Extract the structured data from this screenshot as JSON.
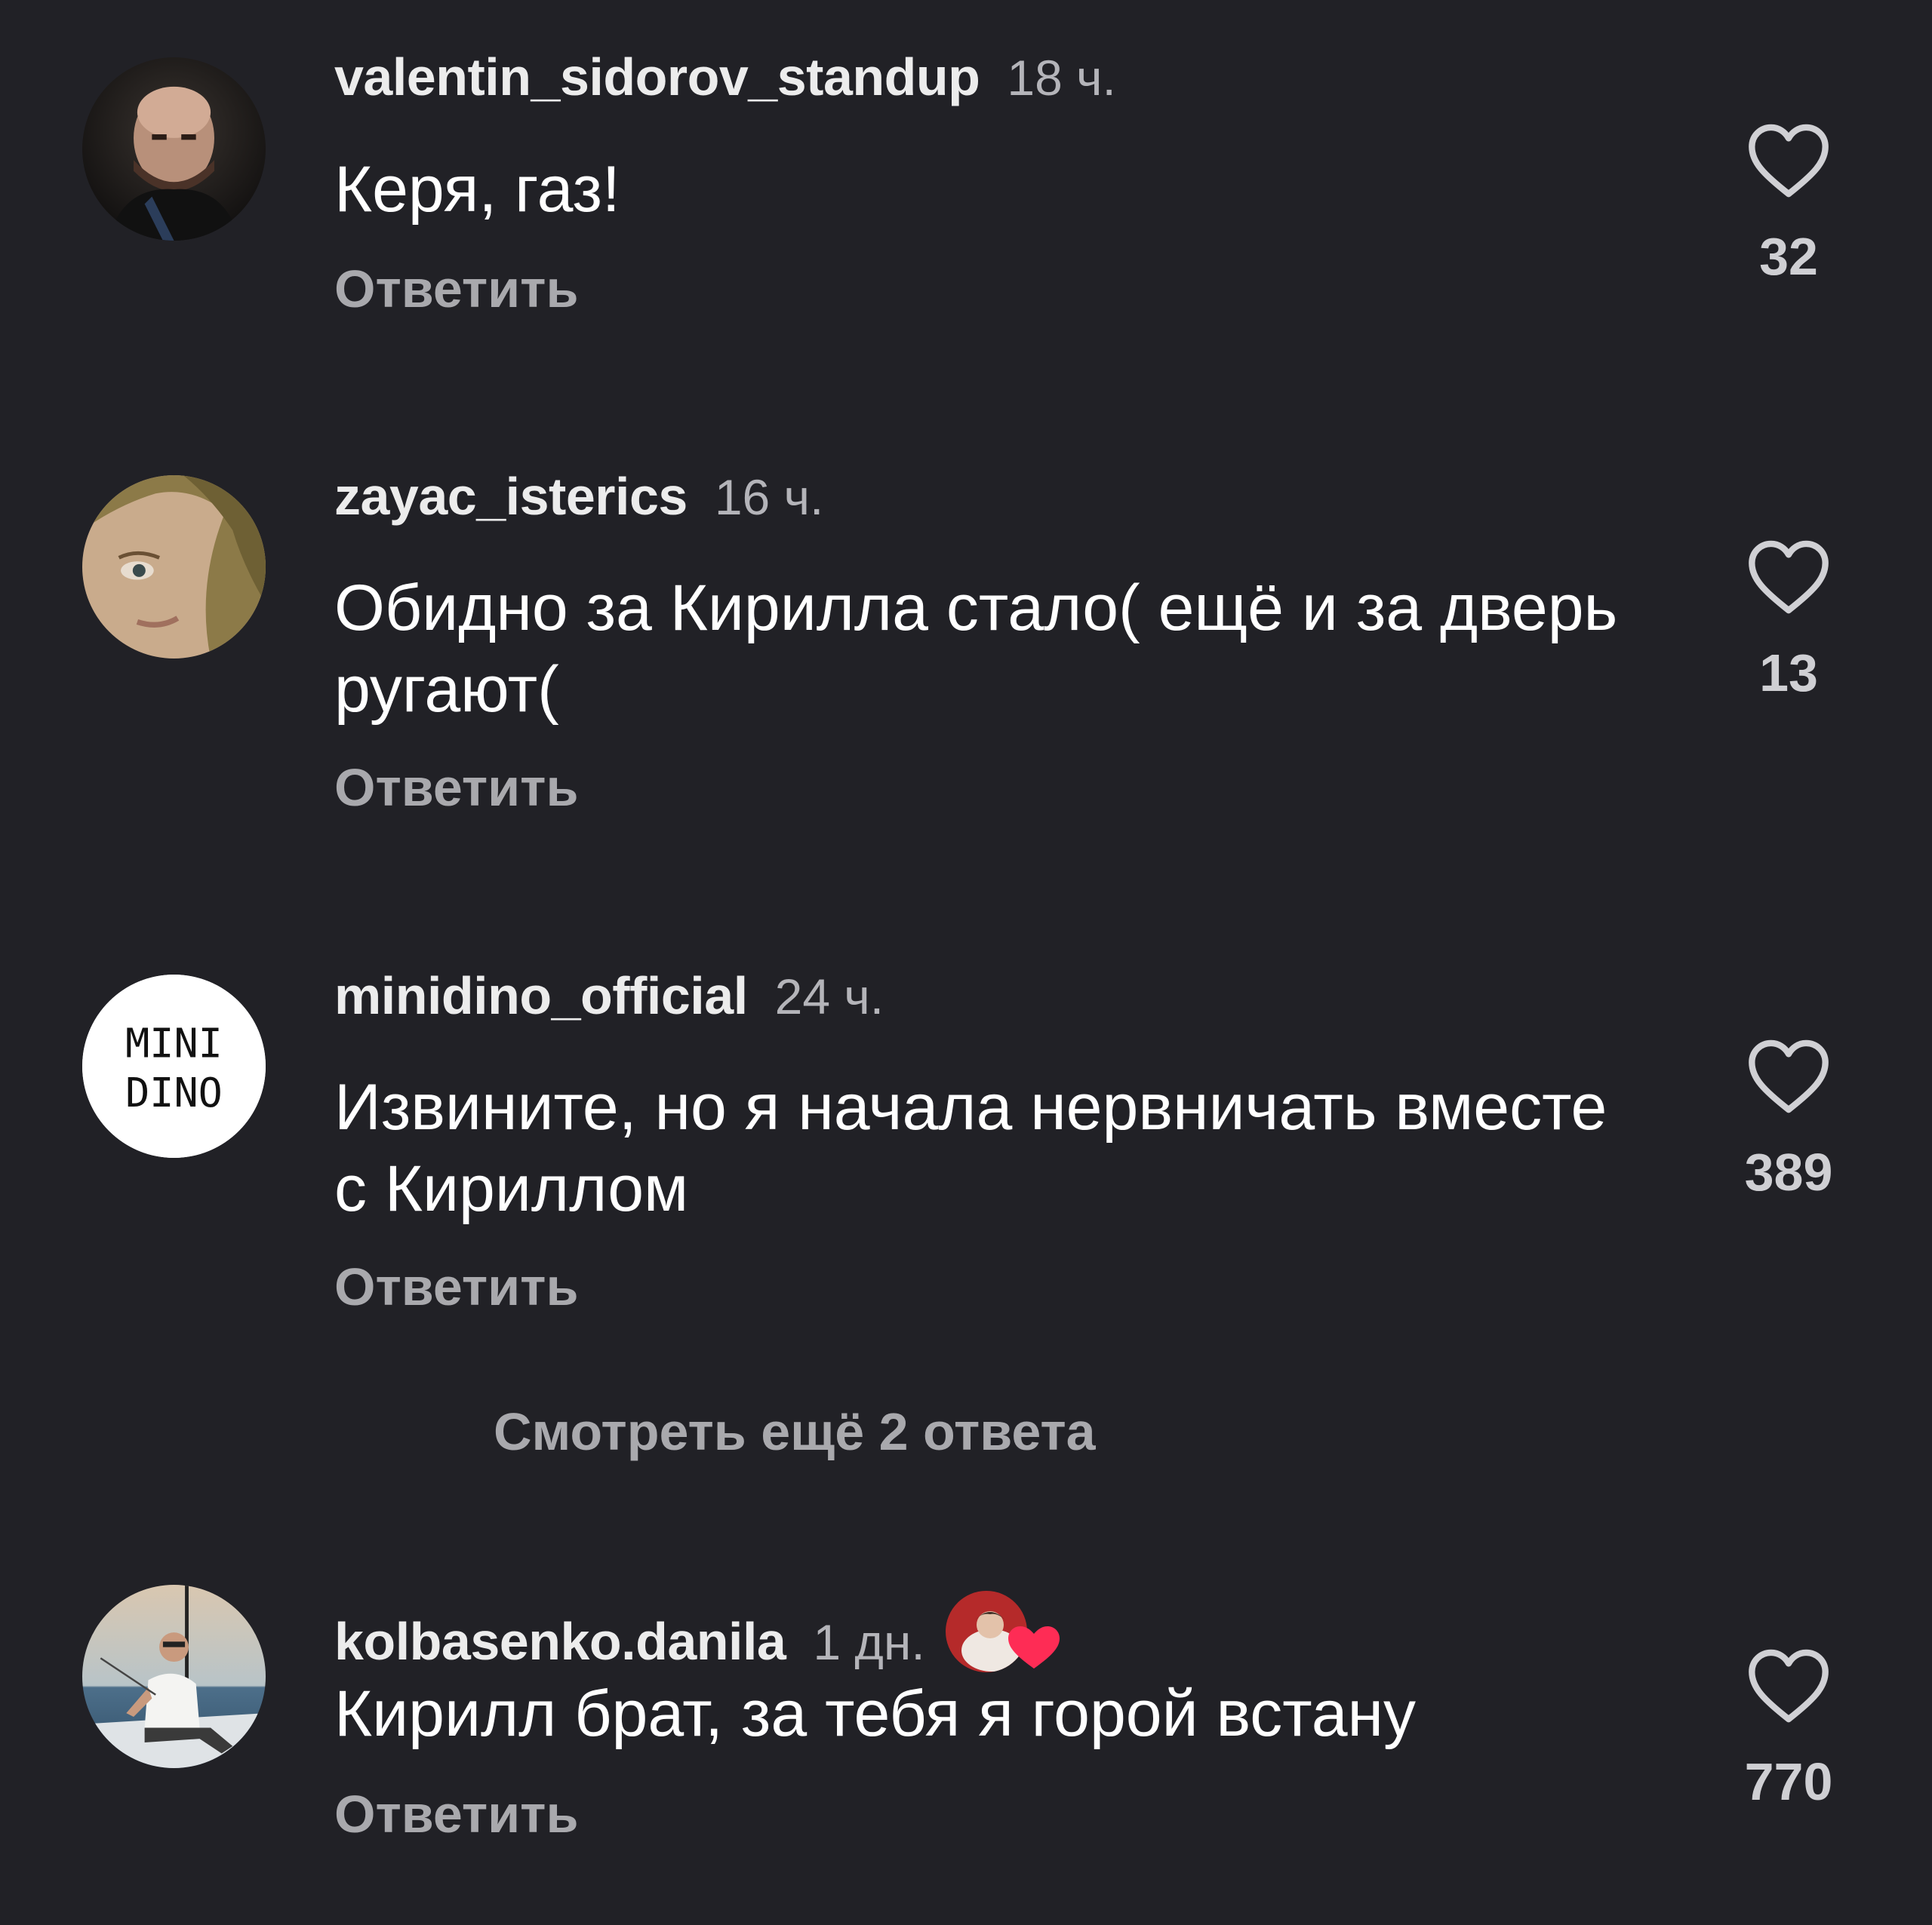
{
  "comments": [
    {
      "username": "valentin_sidorov_standup",
      "time": "18 ч.",
      "text": "Керя, газ!",
      "reply_label": "Ответить",
      "likes": "32",
      "avatar_icon": "bald-man-avatar"
    },
    {
      "username": "zayac_isterics",
      "time": "16 ч.",
      "text": "Обидно за Кирилла стало( ещё и за дверь ругают(",
      "reply_label": "Ответить",
      "likes": "13",
      "avatar_icon": "woman-closeup-avatar"
    },
    {
      "username": "minidino_official",
      "time": "24 ч.",
      "text": "Извините, но я начала нервничать вместе с Кириллом",
      "reply_label": "Ответить",
      "likes": "389",
      "avatar_icon": "minidino-logo-avatar",
      "avatar_logo": {
        "line1": "MINI",
        "line2": "DINO"
      }
    },
    {
      "username": "kolbasenko.danila",
      "time": "1 дн.",
      "text": "Кирилл брат, за тебя я горой встану",
      "reply_label": "Ответить",
      "likes": "770",
      "avatar_icon": "man-on-boat-avatar",
      "creator_liked": true
    }
  ],
  "more_replies_label": "Смотреть ещё 2 ответа",
  "colors": {
    "background": "#212126",
    "username": "#ececec",
    "timestamp": "#b4b4b9",
    "reply": "#a9a9ad",
    "like_count": "#cfcfd3",
    "creator_heart": "#fe2c55"
  }
}
